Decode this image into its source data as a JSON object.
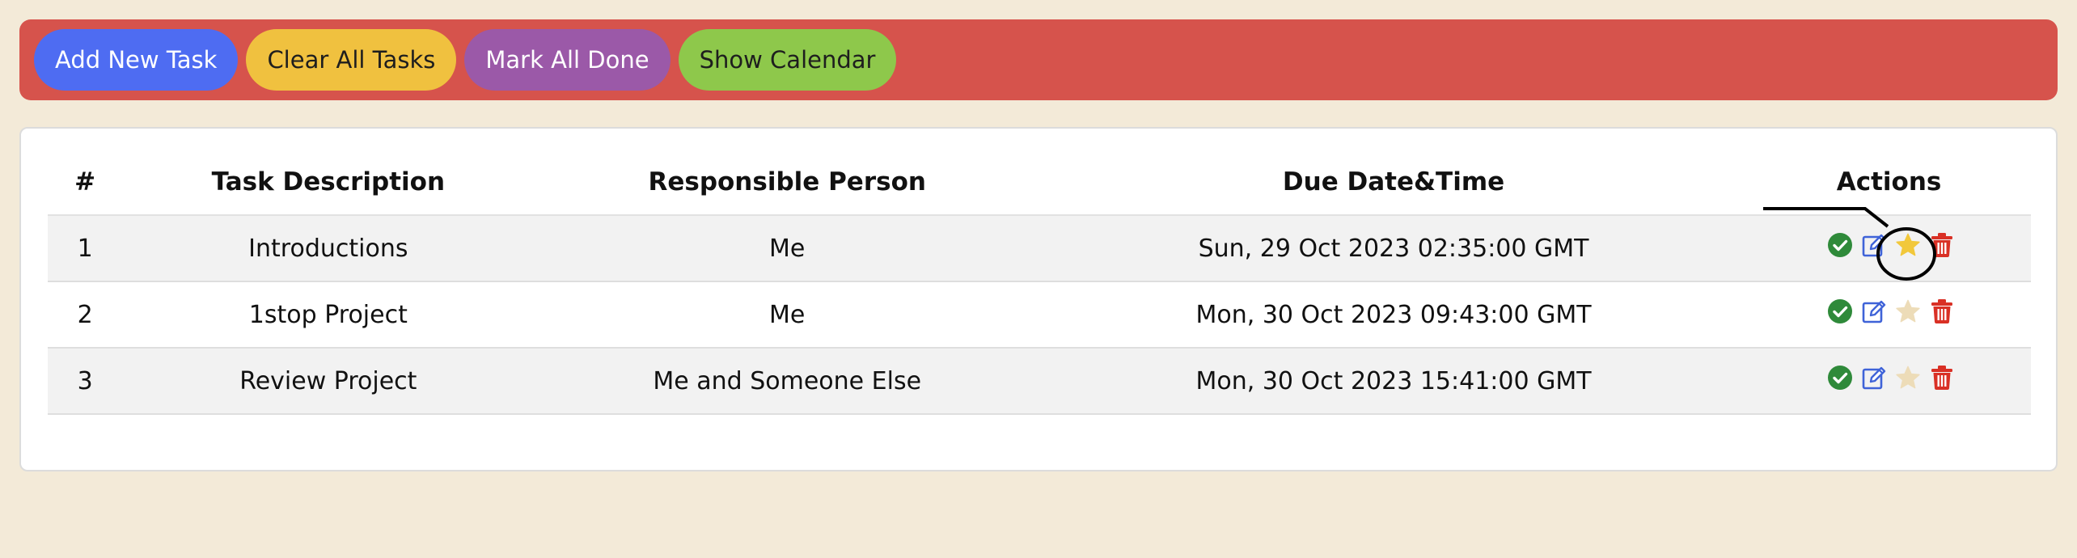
{
  "toolbar": {
    "add_label": "Add New Task",
    "clear_label": "Clear All Tasks",
    "mark_done_label": "Mark All Done",
    "calendar_label": "Show Calendar"
  },
  "table": {
    "headers": {
      "num": "#",
      "description": "Task Description",
      "person": "Responsible Person",
      "due": "Due Date&Time",
      "actions": "Actions"
    },
    "rows": [
      {
        "num": "1",
        "description": "Introductions",
        "person": "Me",
        "due": "Sun, 29 Oct 2023 02:35:00 GMT",
        "starred": true
      },
      {
        "num": "2",
        "description": "1stop Project",
        "person": "Me",
        "due": "Mon, 30 Oct 2023 09:43:00 GMT",
        "starred": false
      },
      {
        "num": "3",
        "description": "Review Project",
        "person": "Me and Someone Else",
        "due": "Mon, 30 Oct 2023 15:41:00 GMT",
        "starred": false
      }
    ]
  },
  "icons": {
    "complete": "check-circle-icon",
    "edit": "edit-icon",
    "star": "star-icon",
    "delete": "trash-icon"
  },
  "colors": {
    "toolbar_bg": "#d6534c",
    "add_button": "#4e6cf2",
    "clear_button": "#f0c13f",
    "mark_done_button": "#9b59a8",
    "calendar_button": "#8ec84b",
    "check": "#2f8a3a",
    "edit": "#3f63d8",
    "star_active": "#f2c83b",
    "star_inactive": "#eddcb8",
    "delete": "#d93025"
  }
}
